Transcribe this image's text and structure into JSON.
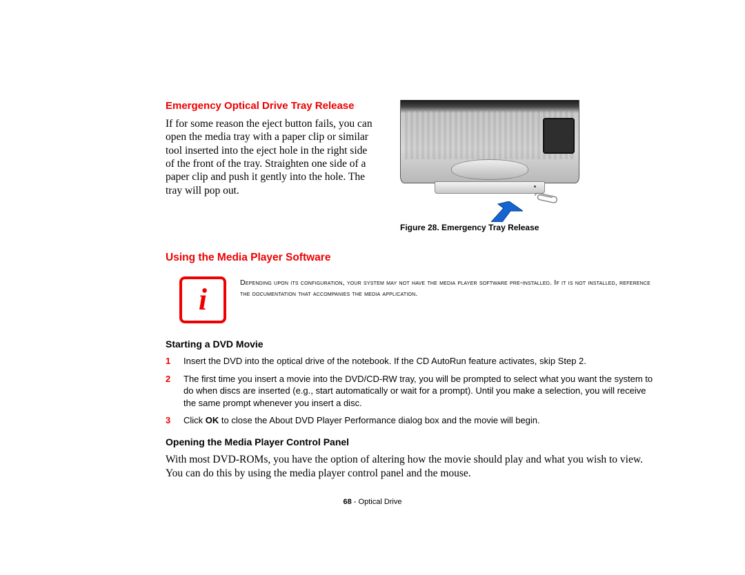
{
  "section1": {
    "heading": "Emergency Optical Drive Tray Release",
    "para": "If for some reason the eject button fails, you can open the media tray with a paper clip or similar tool inserted into the eject hole in the right side of the front of the tray. Straighten one side of a paper clip and push it gently into the hole. The tray will pop out.",
    "figure_caption": "Figure 28.  Emergency Tray Release"
  },
  "section2": {
    "heading": "Using the Media Player Software",
    "info_note": "Depending upon its configuration, your system may not have the media player software pre-installed. If it is not installed, reference the documentation that accompanies the media application.",
    "sub1": "Starting a DVD Movie",
    "steps": [
      {
        "n": "1",
        "text": "Insert the DVD into the optical drive of the notebook. If the CD AutoRun feature activates, skip Step 2."
      },
      {
        "n": "2",
        "text": "The first time you insert a movie into the DVD/CD-RW tray, you will be prompted to select what you want the system to do when discs are inserted (e.g., start automatically or wait for a prompt). Until you make a selection, you will receive the same prompt whenever you insert a disc."
      },
      {
        "n": "3",
        "text_pre": "Click ",
        "bold": "OK",
        "text_post": " to close the About DVD Player Performance dialog box and the movie will begin."
      }
    ],
    "sub2": "Opening the Media Player Control Panel",
    "para2": "With most DVD-ROMs, you have the option of altering how the movie should play and what you wish to view. You can do this by using the media player control panel and the mouse."
  },
  "footer": {
    "page_num": "68",
    "dash": " - ",
    "label": "Optical Drive"
  }
}
